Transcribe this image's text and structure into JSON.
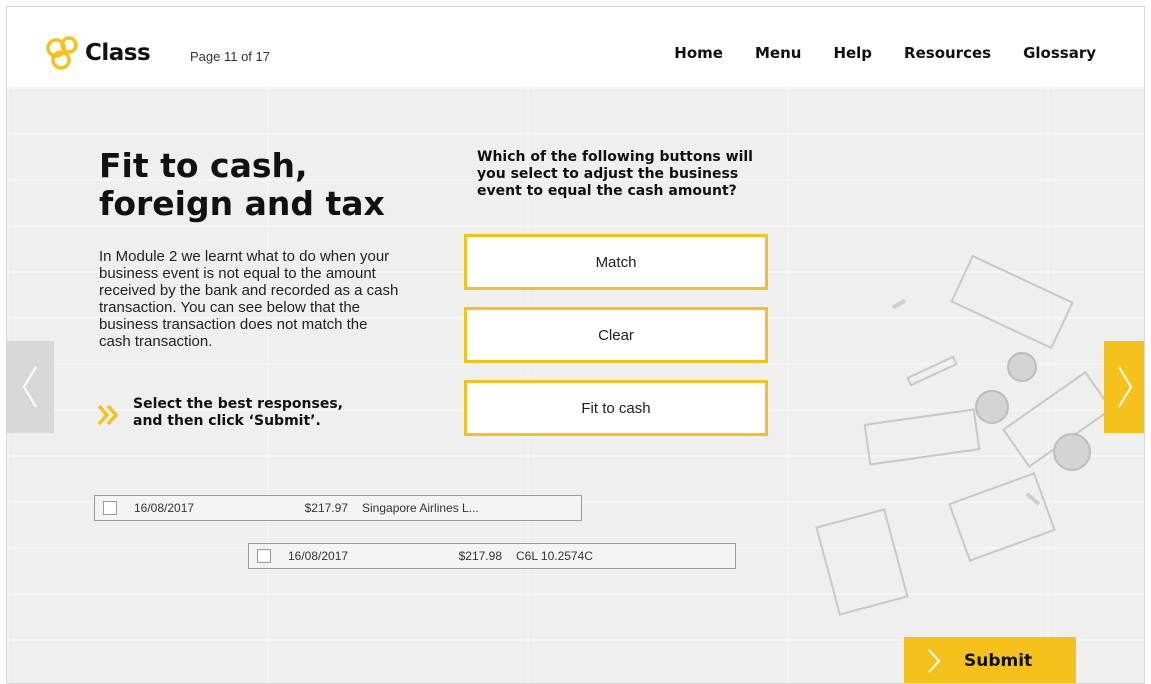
{
  "header": {
    "logo_text": "Class",
    "page_indicator": "Page 11 of 17",
    "nav": [
      "Home",
      "Menu",
      "Help",
      "Resources",
      "Glossary"
    ]
  },
  "main": {
    "title": "Fit to cash, foreign and tax",
    "intro": "In Module 2 we learnt what to do when your business event is not equal to the amount received by the bank and recorded as a cash transaction. You can see below that the business transaction does not match the cash transaction.",
    "instruction": "Select the best responses, and then click ‘Submit’.",
    "question": "Which of the following buttons will you select to adjust the business event to equal the cash amount?",
    "options": [
      "Match",
      "Clear",
      "Fit to cash"
    ],
    "transactions": [
      {
        "date": "16/08/2017",
        "amount": "$217.97",
        "description": "Singapore Airlines L..."
      },
      {
        "date": "16/08/2017",
        "amount": "$217.98",
        "description": "C6L 10.2574C"
      }
    ],
    "submit_label": "Submit"
  },
  "colors": {
    "accent": "#f5c21b",
    "background": "#efefef"
  },
  "icons": {
    "logo": "class-logo-icon",
    "instruction": "double-chevron-right-icon",
    "prev": "chevron-left-icon",
    "next": "chevron-right-icon",
    "submit": "chevron-right-icon"
  }
}
